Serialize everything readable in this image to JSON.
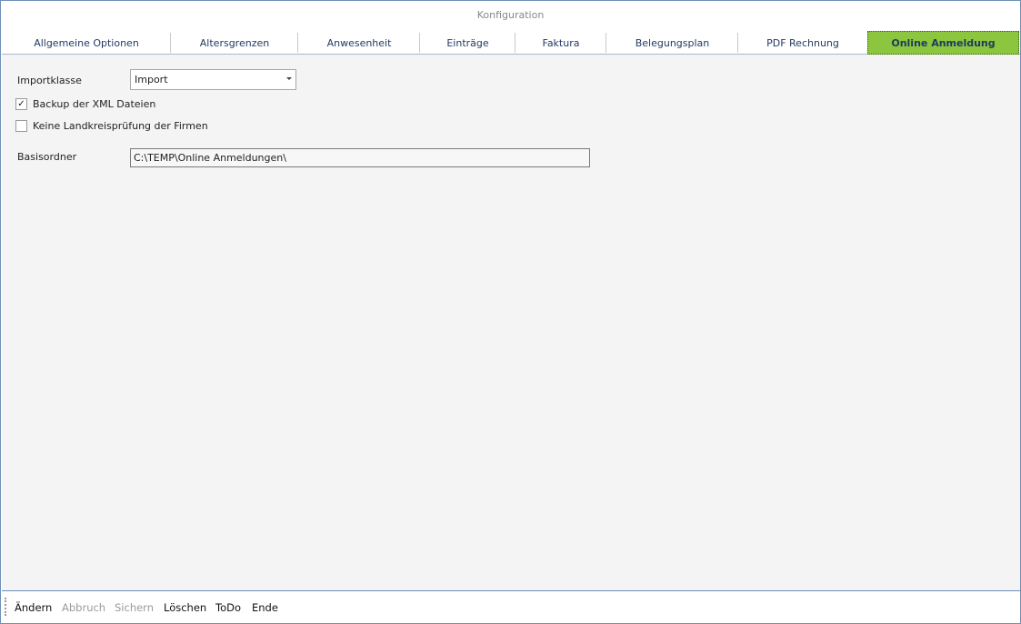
{
  "window": {
    "title": "Konfiguration"
  },
  "tabs": [
    {
      "label": "Allgemeine Optionen",
      "active": false
    },
    {
      "label": "Altersgrenzen",
      "active": false
    },
    {
      "label": "Anwesenheit",
      "active": false
    },
    {
      "label": "Einträge",
      "active": false
    },
    {
      "label": "Faktura",
      "active": false
    },
    {
      "label": "Belegungsplan",
      "active": false
    },
    {
      "label": "PDF Rechnung",
      "active": false
    },
    {
      "label": "Online Anmeldung",
      "active": true
    }
  ],
  "form": {
    "importklasse_label": "Importklasse",
    "importklasse_value": "Import",
    "backup_label": "Backup der XML Dateien",
    "backup_checked": true,
    "landkreis_label": "Keine Landkreisprüfung der Firmen",
    "landkreis_checked": false,
    "check_glyph": "✓",
    "basisordner_label": "Basisordner",
    "basisordner_value": "C:\\TEMP\\Online Anmeldungen\\"
  },
  "footer": {
    "buttons": [
      {
        "label": "Ändern",
        "enabled": true
      },
      {
        "label": "Abbruch",
        "enabled": false
      },
      {
        "label": "Sichern",
        "enabled": false
      },
      {
        "label": "Löschen",
        "enabled": true
      },
      {
        "label": "ToDo",
        "enabled": true
      },
      {
        "label": "Ende",
        "enabled": true
      }
    ]
  },
  "colors": {
    "active_tab": "#8cc63f",
    "tab_text": "#233a63",
    "window_border": "#6d8fb8",
    "content_bg": "#f4f4f4"
  }
}
